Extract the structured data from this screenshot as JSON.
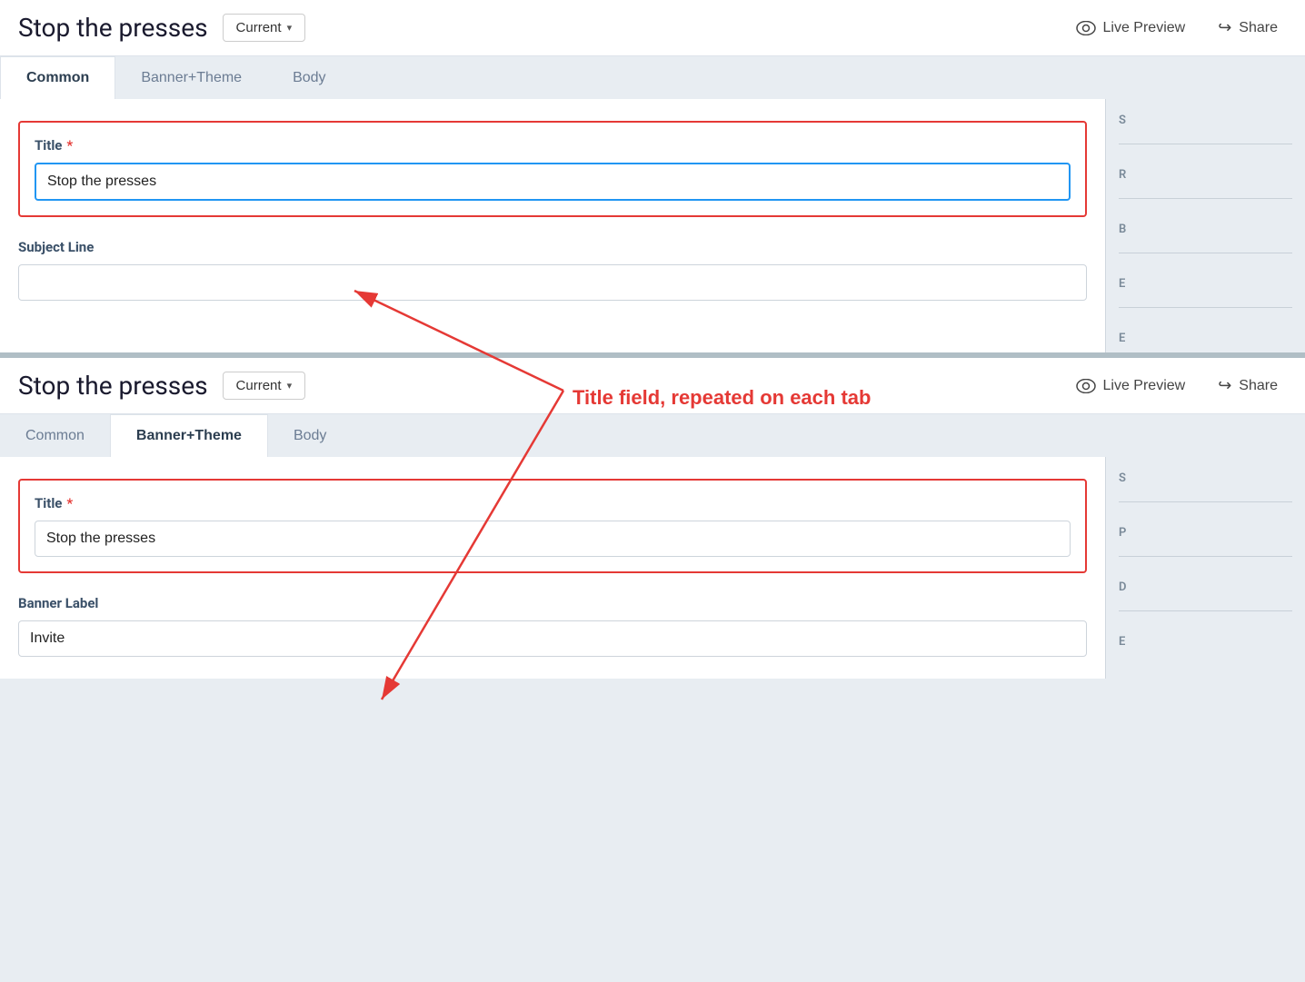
{
  "page": {
    "title": "Stop the presses"
  },
  "header": {
    "title": "Stop the presses",
    "version_label": "Current",
    "version_chevron": "▾",
    "live_preview_label": "Live Preview",
    "share_label": "Share"
  },
  "tabs_top": {
    "items": [
      {
        "id": "common",
        "label": "Common",
        "active": true
      },
      {
        "id": "banner_theme",
        "label": "Banner+Theme",
        "active": false
      },
      {
        "id": "body",
        "label": "Body",
        "active": false
      }
    ]
  },
  "tabs_bottom": {
    "items": [
      {
        "id": "common",
        "label": "Common",
        "active": false
      },
      {
        "id": "banner_theme",
        "label": "Banner+Theme",
        "active": true
      },
      {
        "id": "body",
        "label": "Body",
        "active": false
      }
    ]
  },
  "form_top": {
    "title_label": "Title",
    "title_required": "*",
    "title_value": "Stop the presses",
    "subject_label": "Subject Line",
    "subject_placeholder": ""
  },
  "form_bottom": {
    "title_label": "Title",
    "title_required": "*",
    "title_value": "Stop the presses",
    "banner_label": "Banner Label",
    "banner_value": "Invite"
  },
  "annotation": {
    "text": "Title field, repeated on each tab"
  },
  "right_sidebar_top": {
    "labels": [
      "S",
      "R",
      "B",
      "E",
      "E"
    ]
  },
  "right_sidebar_bottom": {
    "labels": [
      "S",
      "P",
      "D",
      "E"
    ]
  }
}
